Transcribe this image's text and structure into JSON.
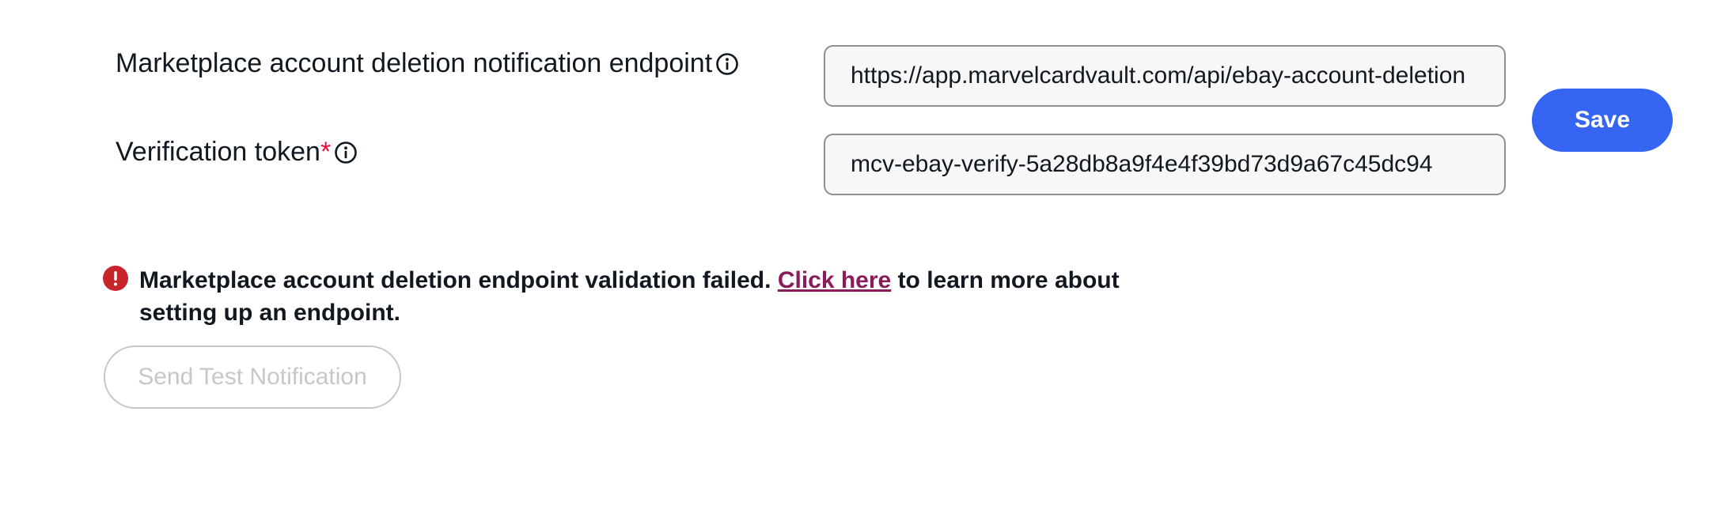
{
  "endpoint": {
    "label": "Marketplace account deletion notification endpoint",
    "value": "https://app.marvelcardvault.com/api/ebay-account-deletion"
  },
  "token": {
    "label": "Verification token",
    "required_mark": "*",
    "value": "mcv-ebay-verify-5a28db8a9f4e4f39bd73d9a67c45dc94"
  },
  "save_button": {
    "label": "Save"
  },
  "alert": {
    "message_before": "Marketplace account deletion endpoint validation failed. ",
    "link_text": "Click here",
    "message_after": " to learn more about setting up an endpoint."
  },
  "test_button": {
    "label": "Send Test Notification"
  },
  "colors": {
    "primary": "#3665f3",
    "error": "#c7242b",
    "link": "#8a1c5b",
    "required": "#e0103a"
  },
  "icons": {
    "info": "info-icon",
    "alert": "alert-circle-icon"
  }
}
